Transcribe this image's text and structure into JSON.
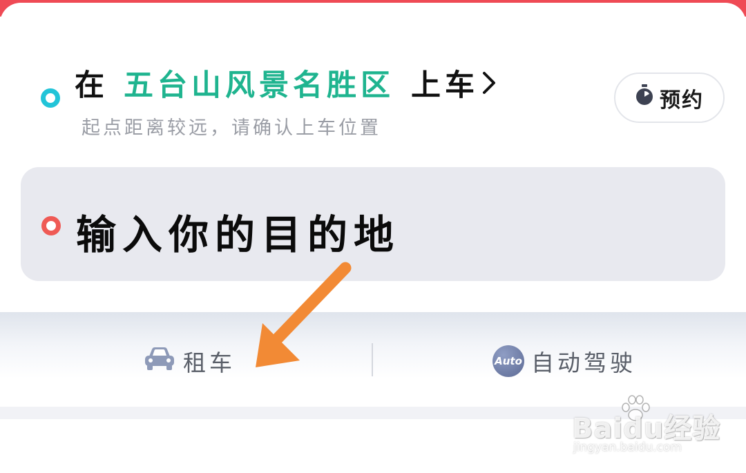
{
  "pickup": {
    "prefix": "在",
    "location": "五台山风景名胜区",
    "suffix": "上车",
    "hint": "起点距离较远，请确认上车位置"
  },
  "reserve": {
    "label": "预约"
  },
  "destination": {
    "placeholder": "输入你的目的地"
  },
  "tabs": [
    {
      "label": "租车",
      "icon": "car-icon"
    },
    {
      "label": "自动驾驶",
      "icon": "auto-icon",
      "icon_text": "Auto"
    }
  ],
  "watermark": {
    "brand": "Baidu经验",
    "url": "jingyan.baidu.com"
  },
  "colors": {
    "accent_green": "#1fb48f",
    "start_dot": "#22c4d8",
    "end_dot": "#ef5a55",
    "arrow": "#f28a35",
    "top_strip": "#ef4a55"
  }
}
